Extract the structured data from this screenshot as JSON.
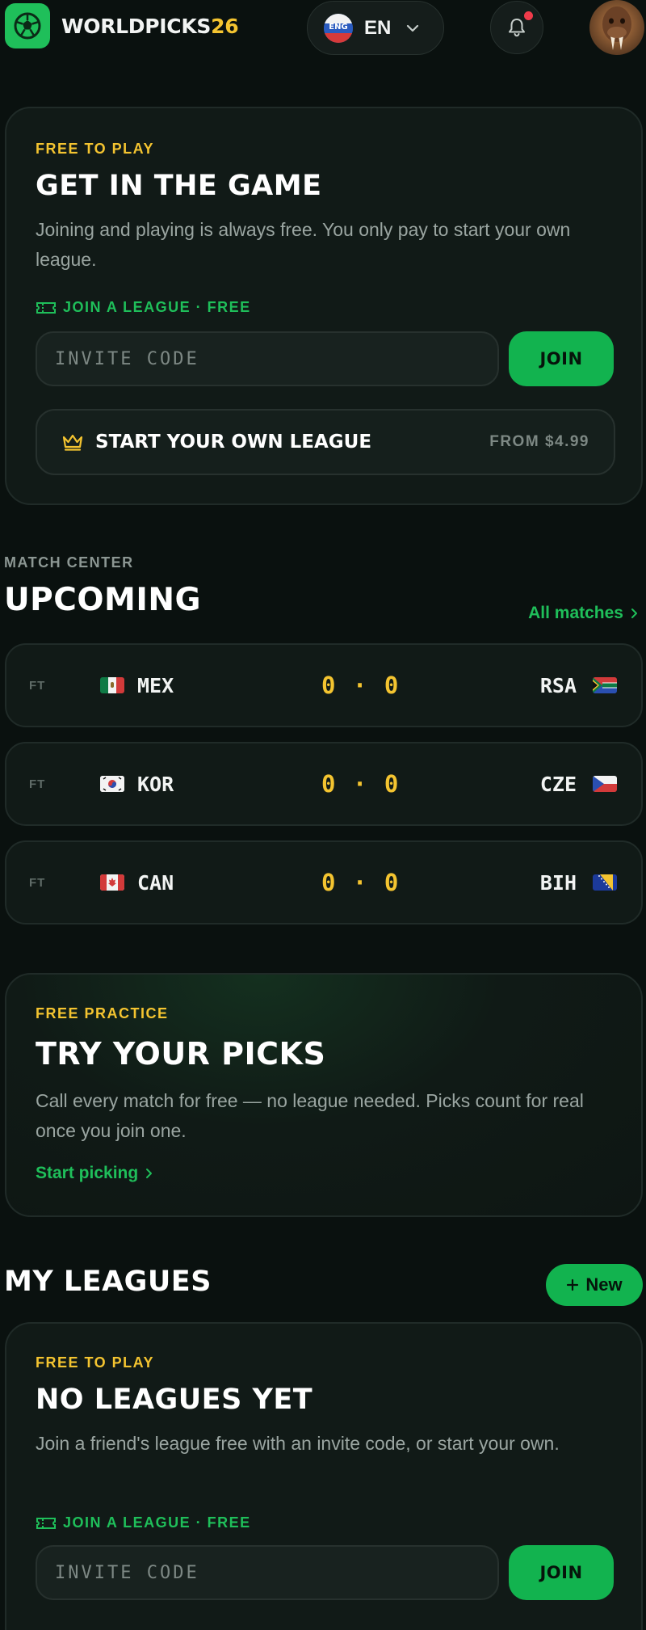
{
  "header": {
    "brand_main": "WORLDPICKS",
    "brand_accent": "26",
    "language": "EN",
    "language_flag_text": "ENG",
    "notification_badge": true
  },
  "join_card": {
    "eyebrow": "FREE TO PLAY",
    "title": "GET IN THE GAME",
    "description": "Joining and playing is always free. You only pay to start your own league.",
    "join_label": "JOIN A LEAGUE · FREE",
    "invite_placeholder": "INVITE CODE",
    "join_button": "JOIN",
    "start_league_label": "START YOUR OWN LEAGUE",
    "start_league_price": "FROM $4.99"
  },
  "match_center": {
    "eyebrow": "MATCH CENTER",
    "title": "UPCOMING",
    "all_matches_link": "All matches",
    "matches": [
      {
        "status": "FT",
        "home": "MEX",
        "score": "0 · 0",
        "away": "RSA"
      },
      {
        "status": "FT",
        "home": "KOR",
        "score": "0 · 0",
        "away": "CZE"
      },
      {
        "status": "FT",
        "home": "CAN",
        "score": "0 · 0",
        "away": "BIH"
      }
    ]
  },
  "practice_card": {
    "eyebrow": "FREE PRACTICE",
    "title": "TRY YOUR PICKS",
    "description": "Call every match for free — no league needed. Picks count for real once you join one.",
    "link": "Start picking"
  },
  "my_leagues": {
    "title": "MY LEAGUES",
    "new_button": "New",
    "empty_card": {
      "eyebrow": "FREE TO PLAY",
      "title": "NO LEAGUES YET",
      "description": "Join a friend's league free with an invite code, or start your own.",
      "join_label": "JOIN A LEAGUE · FREE",
      "invite_placeholder": "INVITE CODE",
      "join_button": "JOIN"
    }
  },
  "colors": {
    "background": "#0a110f",
    "card": "#111a17",
    "accent_green": "#1fbf5a",
    "accent_gold": "#f4c430",
    "muted_text": "#9aa5a1"
  }
}
